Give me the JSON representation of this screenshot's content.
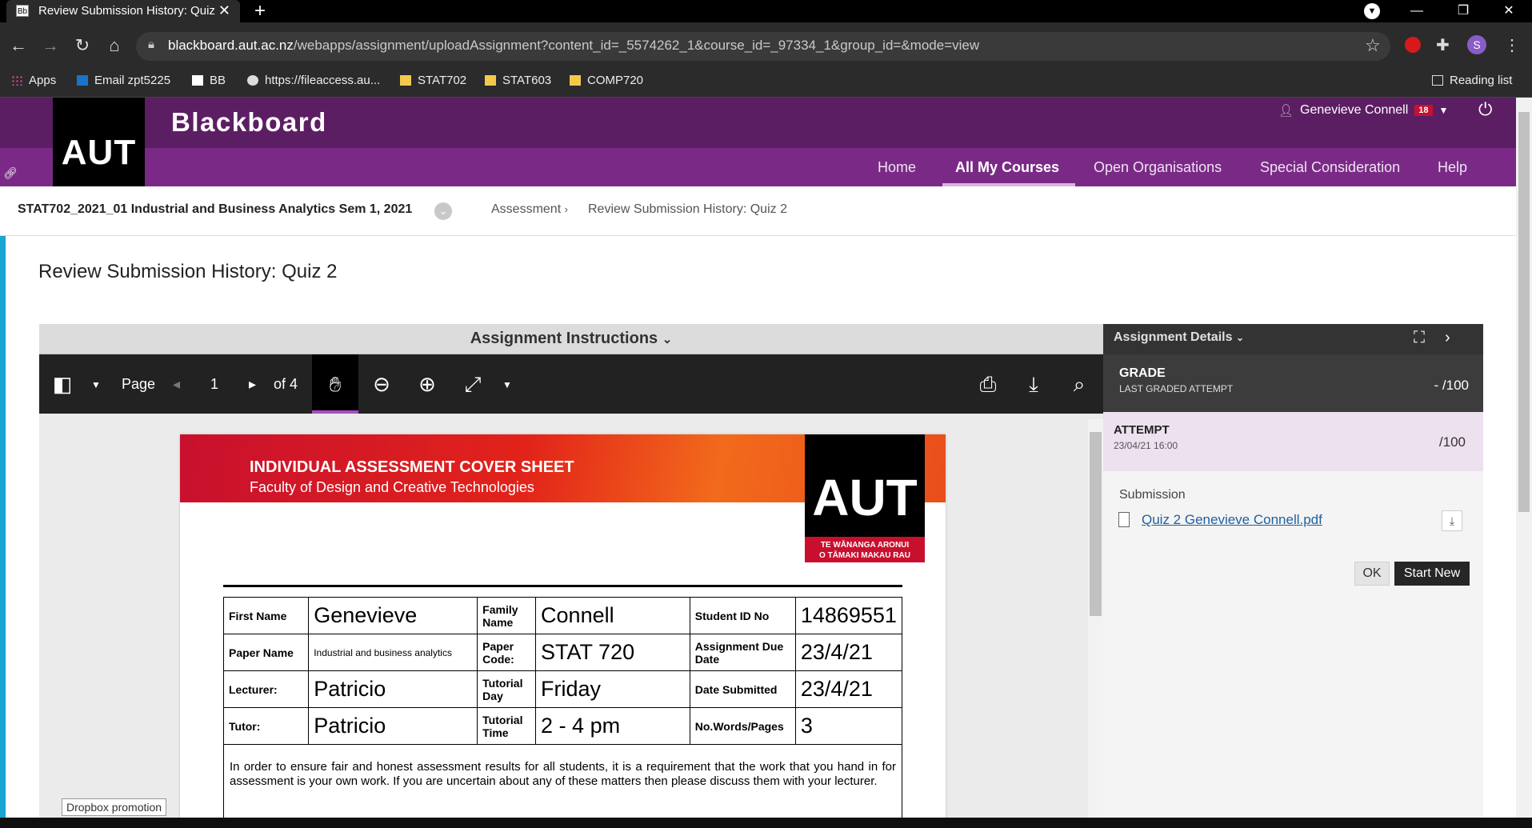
{
  "browser": {
    "tab_title": "Review Submission History: Quiz 2",
    "tab_favicon": "Bb",
    "url_domain": "blackboard.aut.ac.nz",
    "url_path": "/webapps/assignment/uploadAssignment?content_id=_5574262_1&course_id=_97334_1&group_id=&mode=view",
    "profile_initial": "S",
    "bookmarks": [
      "Apps",
      "Email zpt5225",
      "BB",
      "https://fileaccess.au...",
      "STAT702",
      "STAT603",
      "COMP720"
    ],
    "reading_list": "Reading list"
  },
  "header": {
    "logo": "AUT",
    "brand": "Blackboard",
    "user_name": "Genevieve Connell",
    "notification_count": "18",
    "nav": [
      "Home",
      "All My Courses",
      "Open Organisations",
      "Special Consideration",
      "Help"
    ],
    "active_nav": "All My Courses",
    "accent_color": "#7a2a86"
  },
  "breadcrumb": {
    "course": "STAT702_2021_01 Industrial and Business Analytics Sem 1, 2021",
    "items": [
      "Assessment",
      "Review Submission History: Quiz 2"
    ]
  },
  "page_title": "Review Submission History: Quiz 2",
  "viewer": {
    "instructions_label": "Assignment Instructions",
    "page_label": "Page",
    "current_page": "1",
    "page_total": "of 4"
  },
  "document": {
    "banner_title": "INDIVIDUAL ASSESSMENT COVER SHEET",
    "banner_subtitle": "Faculty of Design and Creative Technologies",
    "logo": "AUT",
    "logo_tagline_1": "TE WĀNANGA ARONUI",
    "logo_tagline_2": "O TĀMAKI MAKAU RAU",
    "rows": [
      [
        {
          "label": "First Name"
        },
        {
          "value": "Genevieve"
        },
        {
          "label": "Family Name"
        },
        {
          "value": "Connell"
        },
        {
          "label": "Student ID No"
        },
        {
          "value": "14869551"
        }
      ],
      [
        {
          "label": "Paper Name"
        },
        {
          "value": "Industrial and business analytics",
          "small": true
        },
        {
          "label": "Paper Code:"
        },
        {
          "value": "STAT 720"
        },
        {
          "label": "Assignment Due Date"
        },
        {
          "value": "23/4/21"
        }
      ],
      [
        {
          "label": "Lecturer:"
        },
        {
          "value": "Patricio"
        },
        {
          "label": "Tutorial Day"
        },
        {
          "value": "Friday"
        },
        {
          "label": "Date Submitted"
        },
        {
          "value": "23/4/21"
        }
      ],
      [
        {
          "label": "Tutor:"
        },
        {
          "value": "Patricio"
        },
        {
          "label": "Tutorial Time"
        },
        {
          "value": "2 - 4 pm"
        },
        {
          "label": "No.Words/Pages"
        },
        {
          "value": "3"
        }
      ]
    ],
    "notice": "In order to ensure fair and honest assessment results for all students, it is a requirement that the work that you hand in for assessment is your own work. If you are uncertain about any of these matters then please discuss them with your lecturer."
  },
  "dropbox_label": "Dropbox promotion",
  "details": {
    "title": "Assignment Details",
    "grade_label": "GRADE",
    "grade_sub": "LAST GRADED ATTEMPT",
    "grade_value": "- /100",
    "attempt_label": "ATTEMPT",
    "attempt_date": "23/04/21 16:00",
    "attempt_value": "/100",
    "submission_label": "Submission",
    "file_name": "Quiz 2 Genevieve Connell.pdf",
    "ok_label": "OK",
    "start_new_label": "Start New"
  }
}
